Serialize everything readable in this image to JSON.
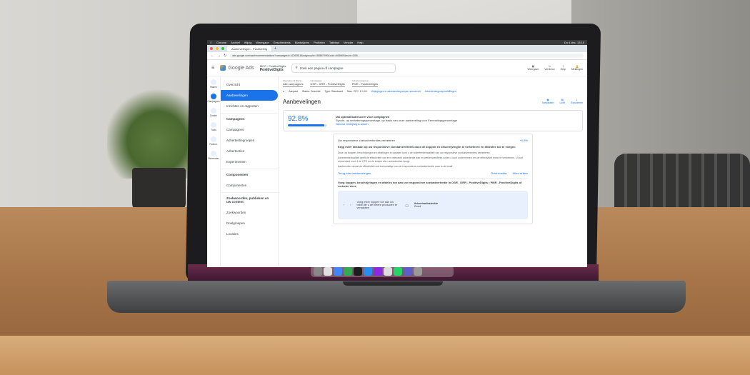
{
  "os_menubar": {
    "items": [
      "Chrome",
      "Archief",
      "Wijzig",
      "Weergave",
      "Geschiedenis",
      "Bladwijzers",
      "Profielen",
      "Tabblad",
      "Venster",
      "Help"
    ],
    "clock": "Do 4 dec. 13:15"
  },
  "browser": {
    "tab_title": "Aanbevelingen - PositiveDig",
    "url": "ads.google.com/aw/recommendations?campaignId=14263816&adgroupId=158867999&ocid=463669&euid=4306..."
  },
  "ads_header": {
    "product": "Google Ads",
    "account_top": "MCC - PositiveDigits",
    "account_name": "PositiveDigits",
    "search_placeholder": "Zoek een pagina of campagne",
    "icons": [
      "Weergave",
      "Vernieuw",
      "Help",
      "Meldingen"
    ]
  },
  "rail": [
    "Maken",
    "Campagnes",
    "Doelen",
    "Tools",
    "Factuur.",
    "Beheerder"
  ],
  "nav": {
    "items": [
      "Overzicht",
      "Aanbevelingen",
      "Inzichten en rapporten"
    ],
    "campaigns_group": "Campagnes",
    "campaigns_items": [
      "Campagnes",
      "Advertentiegroepen",
      "Advertenties",
      "Experimenten"
    ],
    "components_group": "Componenten",
    "components_items": [
      "Componenten"
    ],
    "keywords_group": "Zoekwoorden, publieken en uw content",
    "keywords_items": [
      "Zoekwoorden",
      "Doelgroepen",
      "Locaties"
    ]
  },
  "filters": {
    "campaign_label": "Weergave (3 filters)",
    "campaign_value": "Alle campagnes",
    "campaign2_label": "Campagnes",
    "campaign2_value": "DSR - DRR - PositiveDigits",
    "adgroup_label": "Advertentiegroep",
    "adgroup_value": "PMR - PositiveDigits"
  },
  "status_line": {
    "state": "Aanpast",
    "status": "Status: Geschikt",
    "type": "Type: Standaard",
    "cpc": "Max. CPC: € 1,00",
    "link1": "Wijzigingen in advertentiegroepen simuleren",
    "link2": "Advertentiegroepinstellingen"
  },
  "page_title": "Aanbevelingen",
  "toolbar": [
    "Toepassen",
    "Licht",
    "Exporteren"
  ],
  "optimization": {
    "score": "92.8%",
    "score_fraction": 0.928,
    "title": "Uw optimalisatiescore voor campagnes",
    "line": "Synchr. op verbeteringspercentage, op basis van onze aanbeveling voor Eenmalingspercentage",
    "link": "Nieuwe bedrijfstips ansen"
  },
  "recommendation": {
    "tag": "Uw responsieve zoekadvertenties verbeteren",
    "badge": "+0,8%",
    "title": "Krijg meer kliklaan op uw responsieve zoekadvertenties door de koppen en beschrijvingen te verbeteren en afdeklee toe te voegen",
    "body1": "Door uw koppen, beschrijvingen en afdelingen te updaten kunt u de advertentiekwaliteit van uw responsieve zoekadvertenties verbeteren.",
    "body2": "Advertentiekwaliteit geeft de effectiviteit van een relevante advertentie aan en welke specifieke acties u kunt ondernemen om de effectiviteit ervan te verbeteren. U kunt momenteel over 4 de CTR en de kosten als u advertenties hoogt.",
    "body3": "Aanbevolen omdat de effectiviteit ook toekomstige van de responsieve zoekadvertentie naar is-de kwali",
    "back_link": "Terug naar aanbevelingen",
    "download": "Downloaden",
    "close": "Alles sluiten",
    "suggestion": "Voeg koppen, beschrijvingen en afdeles toe aan uw responsieve zoekadvertentie in DSR - DRR - PositiveDigits • PMR - PositiveDigits of verbeter deze",
    "preview_text": "Voeg meer koppen toe aan uw tekst die u de betere producten te verpakken",
    "strength_label": "Advertentiesterkte",
    "strength_value": "Goed"
  }
}
